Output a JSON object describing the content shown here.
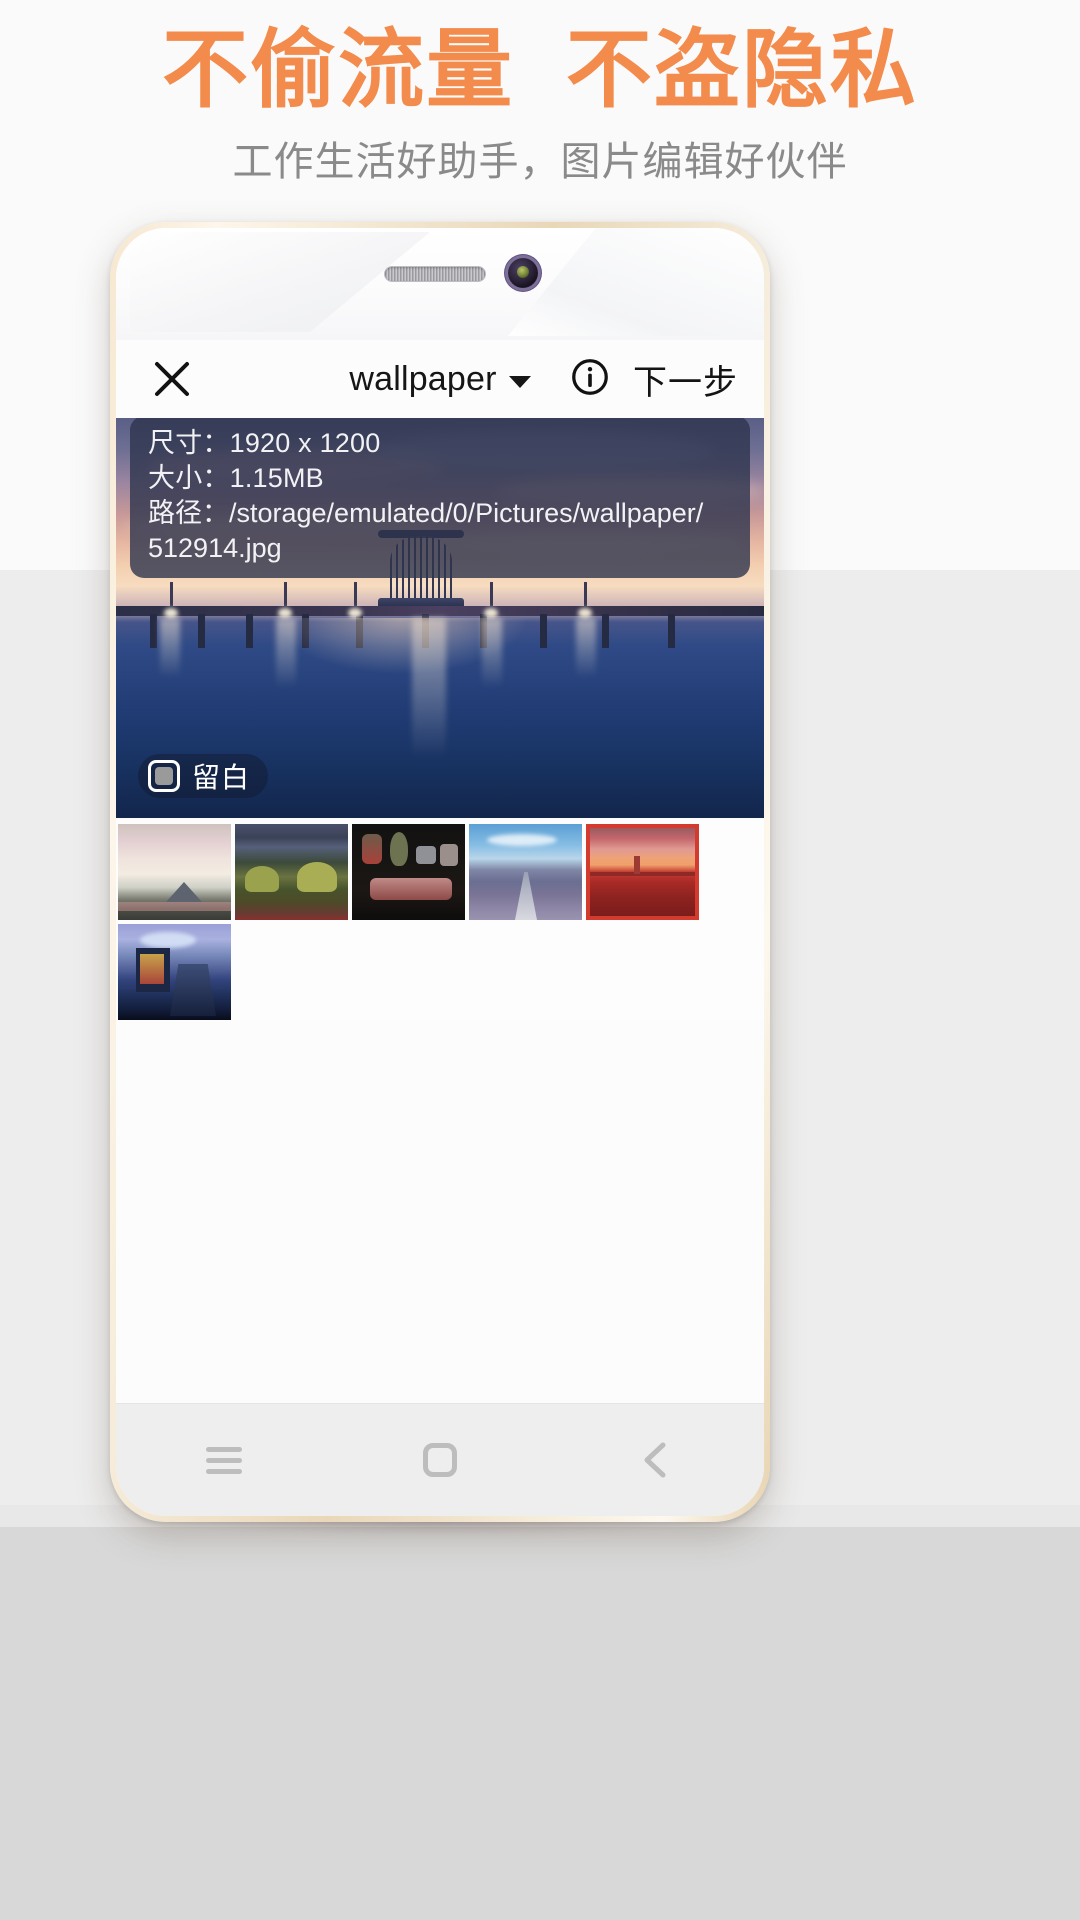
{
  "promo": {
    "headline": "不偷流量  不盗隐私",
    "subtitle": "工作生活好助手，图片编辑好伙伴",
    "headline_color": "#f28b4b",
    "subtitle_color": "#8a8a8a"
  },
  "app": {
    "toolbar": {
      "close_icon": "close-icon",
      "title": "wallpaper",
      "dropdown_icon": "chevron-down-icon",
      "info_icon": "info-circle-icon",
      "next_label": "下一步"
    },
    "info_panel": {
      "dimensions_label": "尺寸：",
      "dimensions_value": "1920 x 1200",
      "size_label": "大小：",
      "size_value": "1.15MB",
      "path_label": "路径：",
      "path_value": "/storage/emulated/0/Pictures/wallpaper/512914.jpg",
      "path_line1": "路径：/storage/emulated/0/Pictures/wallpaper/",
      "path_line2": "512914.jpg",
      "line1": "尺寸：1920 x 1200",
      "line2": "大小：1.15MB"
    },
    "blank_toggle": {
      "label": "留白",
      "checked": "partially",
      "icon": "checkbox-icon"
    },
    "thumbnails": [
      {
        "name": "mountain-lake-pale",
        "selected": false
      },
      {
        "name": "dark-forest-autumn",
        "selected": false
      },
      {
        "name": "steak-food-dark",
        "selected": false
      },
      {
        "name": "lavender-road",
        "selected": false
      },
      {
        "name": "red-pier-sunset",
        "selected": true
      },
      {
        "name": "blue-boathouse-dock",
        "selected": false
      }
    ],
    "navbar": {
      "menu_icon": "menu-icon",
      "home_icon": "home-square-icon",
      "back_icon": "back-chevron-icon"
    }
  },
  "device": {
    "speaker": "speaker-grille",
    "camera": "front-camera",
    "frame_color": "#e9d7b8"
  }
}
